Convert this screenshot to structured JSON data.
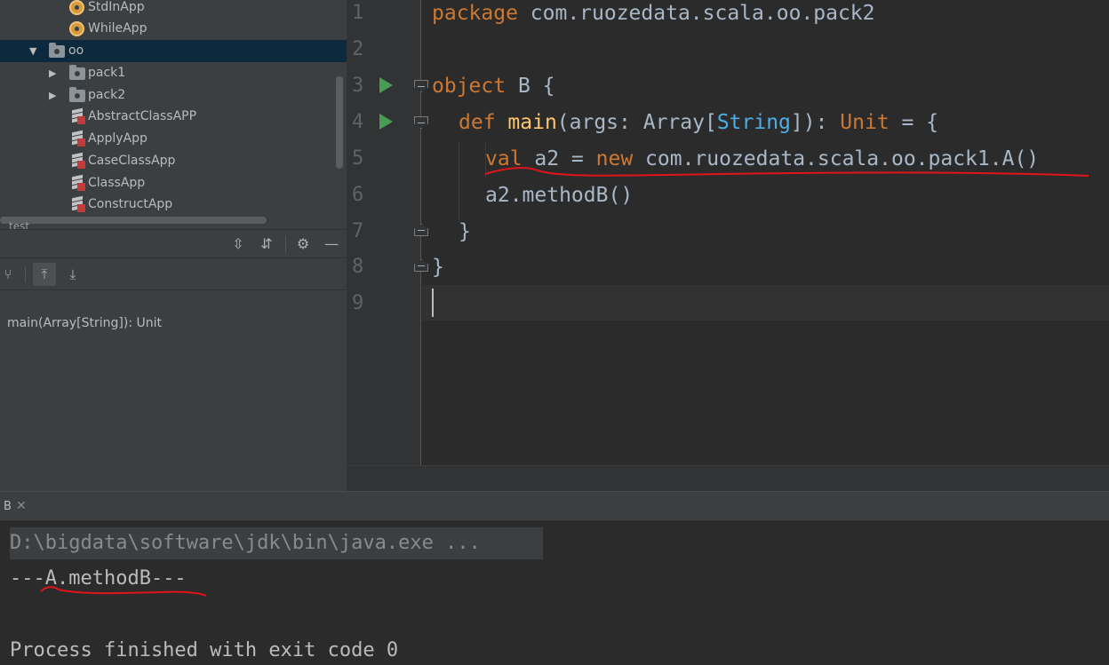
{
  "project_tree": {
    "items": [
      {
        "label": "StdInApp",
        "icon": "scala-object-icon"
      },
      {
        "label": "WhileApp",
        "icon": "scala-object-icon"
      },
      {
        "label": "oo",
        "icon": "package-folder-icon",
        "expanded": true,
        "selected": true
      },
      {
        "label": "pack1",
        "icon": "package-folder-icon",
        "expanded": false
      },
      {
        "label": "pack2",
        "icon": "package-folder-icon",
        "expanded": false
      },
      {
        "label": "AbstractClassAPP",
        "icon": "scala-file-icon"
      },
      {
        "label": "ApplyApp",
        "icon": "scala-file-icon"
      },
      {
        "label": "CaseClassApp",
        "icon": "scala-file-icon"
      },
      {
        "label": "ClassApp",
        "icon": "scala-file-icon"
      },
      {
        "label": "ConstructApp",
        "icon": "scala-file-icon"
      }
    ],
    "cut_off_label": "test"
  },
  "structure": {
    "header_icons": [
      "expand-all-icon",
      "collapse-all-icon",
      "gear-icon",
      "minimize-icon"
    ],
    "toolbar_icons": [
      "hierarchy-icon",
      "sort-up-icon",
      "sort-down-icon"
    ],
    "item": "main(Array[String]): Unit"
  },
  "editor": {
    "line_numbers": [
      "1",
      "2",
      "3",
      "4",
      "5",
      "6",
      "7",
      "8",
      "9"
    ],
    "code": {
      "l1_kw": "package",
      "l1_rest": " com.ruozedata.scala.oo.pack2",
      "l3_kw": "object",
      "l3_rest": " B {",
      "l4_kw": "def",
      "l4_fn": "main",
      "l4_a": "(args: Array[",
      "l4_type": "String",
      "l4_b": "]): ",
      "l4_unit": "Unit",
      "l4_c": " = {",
      "l5_kw1": "val",
      "l5_a": " a2 = ",
      "l5_kw2": "new",
      "l5_b": " com.ruozedata.scala.oo.pack1.A()",
      "l6": "a2.methodB()",
      "l7": "}",
      "l8": "}"
    },
    "annotation_color": "#e0151b"
  },
  "run_panel": {
    "tab_label": "B",
    "output": {
      "command": "D:\\bigdata\\software\\jdk\\bin\\java.exe ...",
      "result": "---A.methodB---",
      "exit": "Process finished with exit code 0"
    }
  }
}
